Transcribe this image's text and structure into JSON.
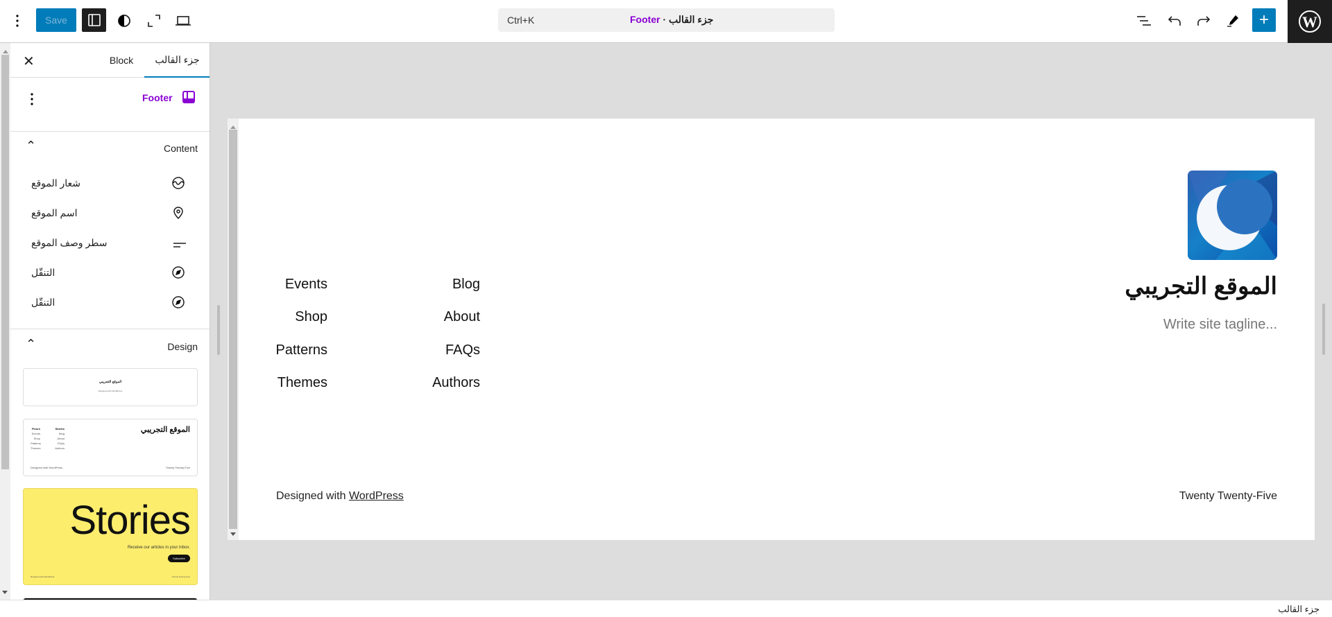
{
  "toolbar": {
    "save_label": "Save",
    "command_shortcut": "Ctrl+K",
    "command_title": "جزء القالب",
    "command_separator": "·",
    "command_name": "Footer"
  },
  "sidebar": {
    "tabs": [
      {
        "label": "جزء القالب",
        "active": true
      },
      {
        "label": "Block",
        "active": false
      }
    ],
    "block_title": "Footer",
    "content_heading": "Content",
    "content_items": [
      {
        "label": "شعار الموقع",
        "icon": "site-logo-icon"
      },
      {
        "label": "اسم الموقع",
        "icon": "map-marker-icon"
      },
      {
        "label": "سطر وصف الموقع",
        "icon": "tagline-icon"
      },
      {
        "label": "التنقّل",
        "icon": "navigation-icon"
      },
      {
        "label": "التنقّل",
        "icon": "navigation-icon"
      }
    ],
    "design_heading": "Design",
    "previews": {
      "p1_title": "الموقع التجريبي",
      "p1_credit": "Designed with WordPress",
      "p2_title": "الموقع التجريبي",
      "p2_col1_head": "Fleurs",
      "p2_col2_head": "Stories",
      "p2_col1": [
        "Events",
        "Shop",
        "Patterns",
        "Themes"
      ],
      "p2_col2": [
        "Blog",
        "About",
        "FAQs",
        "Authors"
      ],
      "p2_credit": "Designed with WordPress",
      "p2_theme": "Twenty Twenty-Five",
      "p3_title": "Stories",
      "p3_sub": "Receive our articles in your inbox.",
      "p3_button": "Subscribe",
      "p3_credit": "Designed with WordPress",
      "p3_theme": "Twenty Twenty-Five"
    }
  },
  "canvas": {
    "site_title": "الموقع التجريبي",
    "tagline": "Write site tagline...",
    "nav_col1": [
      "Events",
      "Shop",
      "Patterns",
      "Themes"
    ],
    "nav_col2": [
      "Blog",
      "About",
      "FAQs",
      "Authors"
    ],
    "credit_prefix": "Designed with ",
    "credit_link": "WordPress",
    "theme_name": "Twenty Twenty-Five"
  },
  "status_bar": {
    "breadcrumb": "جزء القالب"
  },
  "colors": {
    "accent": "#007cba",
    "template_part": "#8a00d4",
    "dark": "#1e1e1e"
  }
}
